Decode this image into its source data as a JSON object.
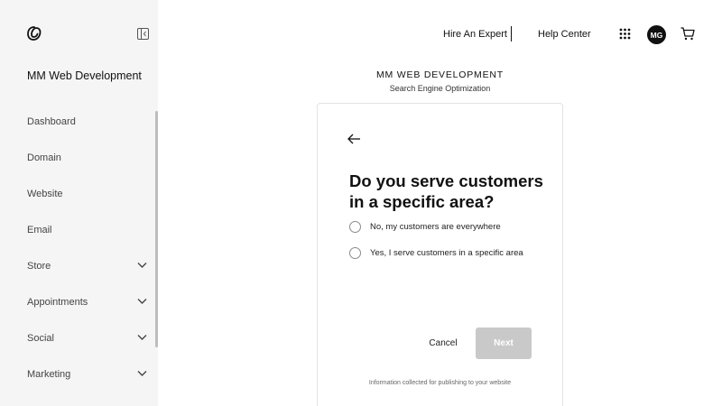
{
  "sidebar": {
    "site_title": "MM Web Development",
    "items": [
      {
        "label": "Dashboard",
        "has_chevron": false
      },
      {
        "label": "Domain",
        "has_chevron": false
      },
      {
        "label": "Website",
        "has_chevron": false
      },
      {
        "label": "Email",
        "has_chevron": false
      },
      {
        "label": "Store",
        "has_chevron": true
      },
      {
        "label": "Appointments",
        "has_chevron": true
      },
      {
        "label": "Social",
        "has_chevron": true
      },
      {
        "label": "Marketing",
        "has_chevron": true
      }
    ]
  },
  "header": {
    "hire_expert": "Hire An Expert",
    "help_center": "Help Center",
    "avatar_initials": "MG"
  },
  "main": {
    "business_name": "MM WEB DEVELOPMENT",
    "subtitle": "Search Engine Optimization",
    "question": "Do you serve customers in a specific area?",
    "options": [
      {
        "label": "No, my customers are everywhere",
        "selected": false
      },
      {
        "label": "Yes, I serve customers in a specific area",
        "selected": false
      }
    ],
    "cancel_label": "Cancel",
    "next_label": "Next",
    "next_enabled": false,
    "info_note": "Information collected for publishing to your website"
  },
  "icons": {
    "logo": "godaddy-logo-icon",
    "collapse": "sidebar-collapse-icon",
    "apps": "apps-grid-icon",
    "cart": "cart-icon",
    "back": "arrow-left-icon",
    "chevron": "chevron-down-icon"
  },
  "colors": {
    "sidebar_bg": "#f5f5f5",
    "avatar_bg": "#111111",
    "next_disabled_bg": "#c9c9c9"
  }
}
